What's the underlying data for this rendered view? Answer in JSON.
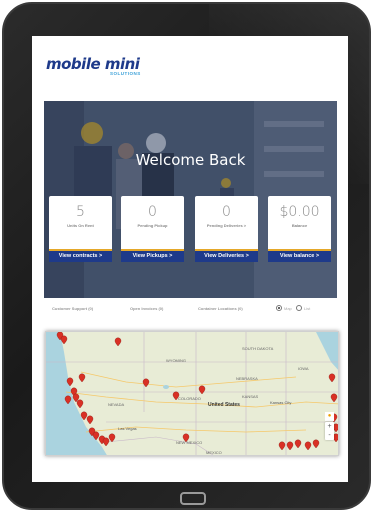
{
  "brand": {
    "name": "mobile mini",
    "tagline": "SOLUTIONS",
    "primary": "#1e3a8a",
    "accent": "#e5a829",
    "link": "#3aa0d8"
  },
  "hero": {
    "title": "Welcome Back"
  },
  "cards": [
    {
      "value": "5",
      "label": "Units On Rent",
      "action": "View contracts >"
    },
    {
      "value": "0",
      "label": "Pending Pickup",
      "action": "View Pickups >"
    },
    {
      "value": "0",
      "label": "Pending Deliveries >",
      "action": "View Deliveries >"
    },
    {
      "value": "$0.00",
      "label": "Balance",
      "action": "View balance >"
    }
  ],
  "tabs": [
    {
      "label": "Customer Support (0)"
    },
    {
      "label": "Open Invoices (0)"
    },
    {
      "label": "Container Locations (0)"
    }
  ],
  "view_toggle": {
    "options": [
      "Map",
      "List"
    ],
    "selected": "Map"
  },
  "map": {
    "labels": [
      "NEVADA",
      "United States",
      "Las Vegas",
      "MEXICO",
      "NEW MEXICO",
      "COLORADO",
      "NEBRASKA",
      "KANSAS",
      "IOWA",
      "Kansas City",
      "WYOMING",
      "SOUTH DAKOTA"
    ],
    "zoom_in": "+",
    "zoom_out": "-",
    "marker_color": "#d93025"
  }
}
